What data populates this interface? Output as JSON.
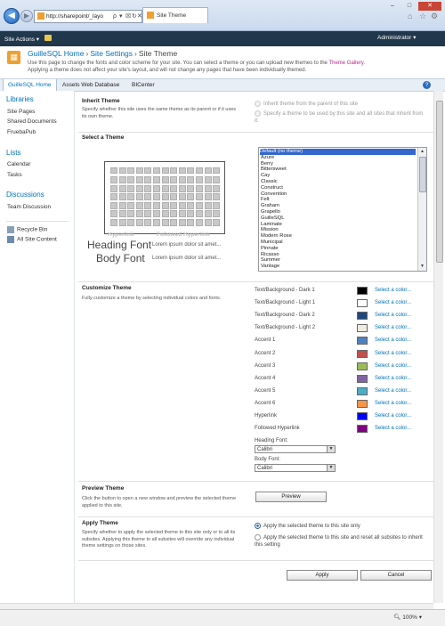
{
  "browser": {
    "address": "http://sharepoint/_layo",
    "tab_title": "Site Theme",
    "back_glyph": "◀",
    "forward_glyph": "▶",
    "tool_glyphs": [
      "ρ",
      "▾",
      "☒",
      "↻",
      "✕"
    ],
    "win_min": "–",
    "win_max": "□",
    "win_close": "✕",
    "home_icon": "⌂",
    "star_icon": "☆",
    "gear_icon": "⚙"
  },
  "sp_bar": {
    "site_actions": "Site Actions ▾",
    "user": "Administrator ▾"
  },
  "title": {
    "site": "GuilleSQL Home",
    "sep": "›",
    "settings": "Site Settings",
    "current": "Site Theme",
    "desc_1": "Use this page to change the fonts and color scheme for your site. You can select a theme or you can upload new themes to the",
    "desc_link": "Theme Gallery.",
    "desc_2": "Applying a theme does not affect your site's layout, and will not change any pages that have been individually themed."
  },
  "topnav": {
    "items": [
      "GuilleSQL Home",
      "Assets Web Database",
      "BICenter"
    ],
    "help": "?"
  },
  "quicklaunch": {
    "libraries": "Libraries",
    "library_items": [
      "Site Pages",
      "Shared Documents",
      "FruebaPub"
    ],
    "lists": "Lists",
    "list_items": [
      "Calendar",
      "Tasks"
    ],
    "discussions": "Discussions",
    "discussion_items": [
      "Team Discussion"
    ],
    "recycle_bin": "Recycle Bin",
    "all_site_content": "All Site Content"
  },
  "inherit": {
    "title": "Inherit Theme",
    "desc": "Specify whether this site uses the same theme as its parent or if it uses its own theme.",
    "opt1": "Inherit theme from the parent of this site",
    "opt2": "Specify a theme to be used by this site and all sites that inherit from it:"
  },
  "select": {
    "title": "Select a Theme",
    "hyperlink": "Hyperlink",
    "followed": "Followed Hyperlink",
    "heading_font": "Heading Font",
    "body_font": "Body Font",
    "lorem": "Lorem ipsum dolor sit amet...",
    "themes": [
      "Default (no theme)",
      "Azure",
      "Berry",
      "Bittersweet",
      "Cay",
      "Classic",
      "Construct",
      "Convention",
      "Felt",
      "Graham",
      "Grapello",
      "GuilleSQL",
      "Laminate",
      "Mission",
      "Modern Rose",
      "Municipal",
      "Pinnate",
      "Ricasso",
      "Summer",
      "Vantage"
    ]
  },
  "customize": {
    "title": "Customize Theme",
    "desc": "Fully customize a theme by selecting individual colors and fonts.",
    "select_color": "Select a color...",
    "colors": [
      {
        "label": "Text/Background - Dark 1",
        "color": "#000000"
      },
      {
        "label": "Text/Background - Light 1",
        "color": "#ffffff"
      },
      {
        "label": "Text/Background - Dark 2",
        "color": "#1f497d"
      },
      {
        "label": "Text/Background - Light 2",
        "color": "#eeece1"
      },
      {
        "label": "Accent 1",
        "color": "#4f81bd"
      },
      {
        "label": "Accent 2",
        "color": "#c0504d"
      },
      {
        "label": "Accent 3",
        "color": "#9bbb59"
      },
      {
        "label": "Accent 4",
        "color": "#8064a2"
      },
      {
        "label": "Accent 5",
        "color": "#4bacc6"
      },
      {
        "label": "Accent 6",
        "color": "#f79646"
      },
      {
        "label": "Hyperlink",
        "color": "#0000ff"
      },
      {
        "label": "Followed Hyperlink",
        "color": "#800080"
      }
    ],
    "heading_font_label": "Heading Font:",
    "heading_font_value": "Calibri",
    "body_font_label": "Body Font:",
    "body_font_value": "Calibri"
  },
  "preview": {
    "title": "Preview Theme",
    "desc": "Click the button to open a new window and preview the selected theme applied to this site.",
    "button": "Preview"
  },
  "apply": {
    "title": "Apply Theme",
    "desc": "Specify whether to apply the selected theme to this site only or to all its subsites. Applying this theme to all subsites will override any individual theme settings on those sites.",
    "opt1": "Apply the selected theme to this site only",
    "opt2": "Apply the selected theme to this site and reset all subsites to inherit this setting",
    "apply_button": "Apply",
    "cancel_button": "Cancel"
  },
  "status": {
    "zoom": "100%"
  }
}
